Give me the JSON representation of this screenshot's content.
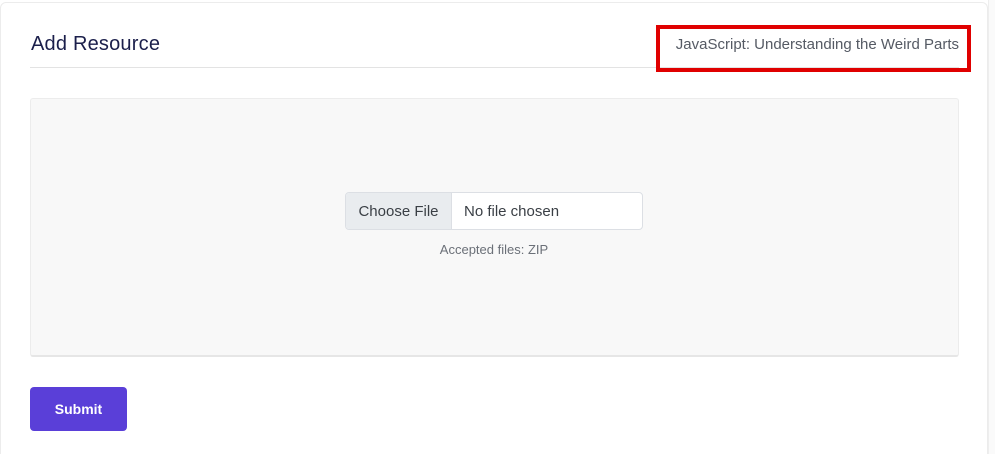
{
  "header": {
    "title": "Add Resource",
    "course_name": "JavaScript: Understanding the Weird Parts"
  },
  "upload": {
    "choose_label": "Choose File",
    "status": "No file chosen",
    "accepted": "Accepted files: ZIP"
  },
  "actions": {
    "submit_label": "Submit"
  },
  "colors": {
    "accent": "#5a3fd8",
    "highlight": "#e00000"
  }
}
